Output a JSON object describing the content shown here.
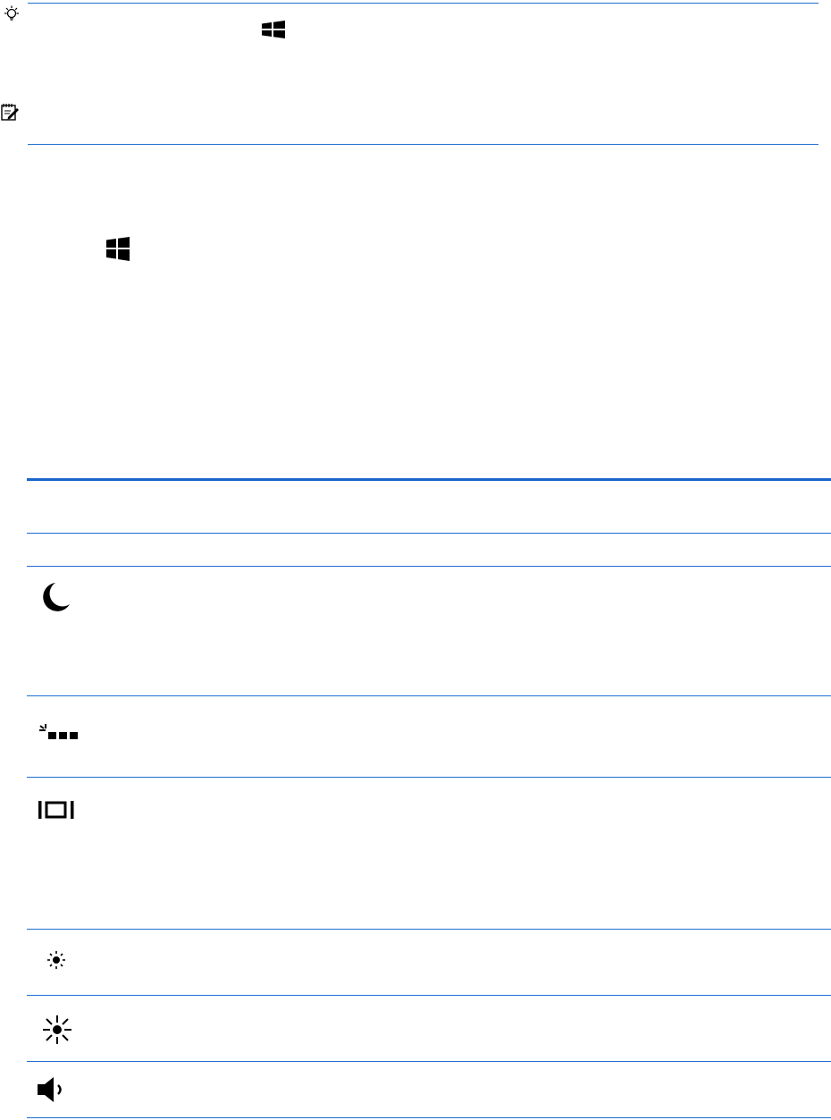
{
  "page": {
    "background": "#ffffff",
    "rule_color": "#1f6fd1"
  },
  "notes": [
    {
      "kind": "tip",
      "icon": "lightbulb-icon",
      "inline_icon": "windows-key-icon"
    },
    {
      "kind": "note",
      "icon": "note-pad-icon"
    }
  ],
  "steps": [
    {
      "icon": "windows-key-icon"
    }
  ],
  "action_keys_table": {
    "rows": [
      {
        "icon": "sleep-moon-icon"
      },
      {
        "icon": "keyboard-backlight-icon"
      },
      {
        "icon": "screen-switch-icon"
      },
      {
        "icon": "brightness-down-icon"
      },
      {
        "icon": "brightness-up-icon"
      },
      {
        "icon": "speaker-volume-icon"
      }
    ]
  }
}
